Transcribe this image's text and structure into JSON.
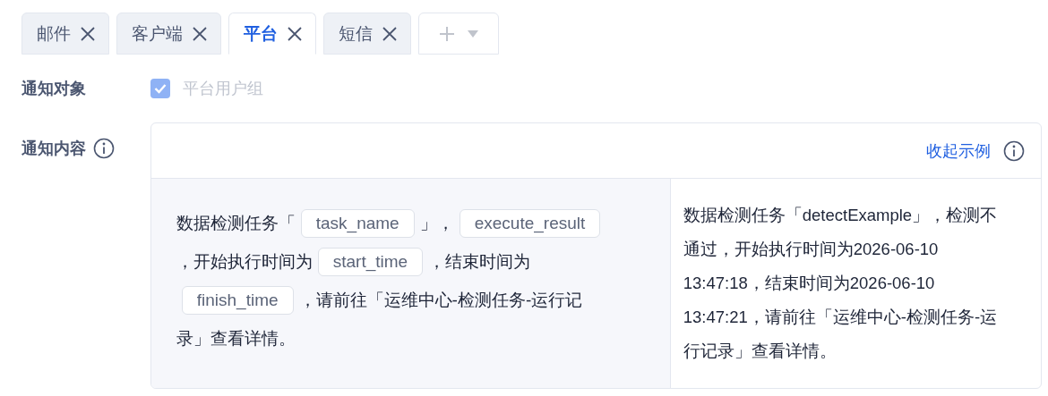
{
  "tabs": [
    {
      "label": "邮件",
      "selected": false
    },
    {
      "label": "客户端",
      "selected": false
    },
    {
      "label": "平台",
      "selected": true
    },
    {
      "label": "短信",
      "selected": false
    }
  ],
  "form": {
    "target": {
      "label": "通知对象",
      "option": {
        "label": "平台用户组",
        "checked": true,
        "disabled": true
      }
    },
    "content": {
      "label": "通知内容",
      "toggle_link": "收起示例",
      "template": [
        {
          "kind": "text",
          "text": "数据检测任务「"
        },
        {
          "kind": "token",
          "text": "task_name"
        },
        {
          "kind": "text",
          "text": "」，"
        },
        {
          "kind": "token",
          "text": "execute_result"
        },
        {
          "kind": "text",
          "text": "，开始执行时间为"
        },
        {
          "kind": "token",
          "text": "start_time"
        },
        {
          "kind": "text",
          "text": "，结束时间为"
        },
        {
          "kind": "token",
          "text": "finish_time"
        },
        {
          "kind": "text",
          "text": "，请前往「运维中心-检测任务-运行记"
        },
        {
          "kind": "text",
          "text": "录」查看详情。"
        }
      ],
      "preview": "数据检测任务「detectExample」，检测不通过，开始执行时间为2026-06-10 13:47:18，结束时间为2026-06-10 13:47:21，请前往「运维中心-检测任务-运行记录」查看详情。"
    }
  }
}
